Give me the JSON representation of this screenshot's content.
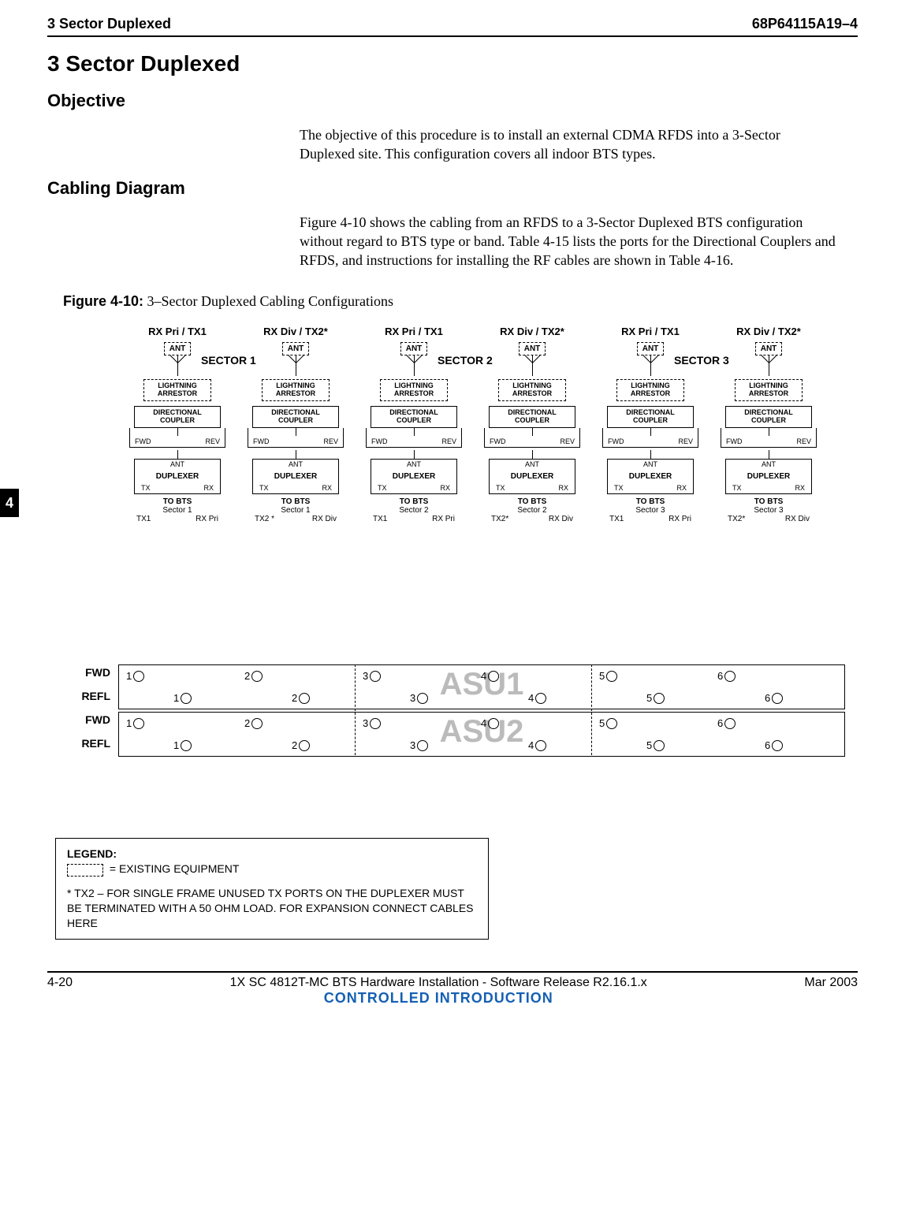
{
  "header": {
    "left": "3 Sector Duplexed",
    "right": "68P64115A19–4"
  },
  "title": "3 Sector Duplexed",
  "objective": {
    "heading": "Objective",
    "text": "The objective of this procedure is to install an external CDMA RFDS into a 3-Sector Duplexed site. This configuration covers all indoor BTS types."
  },
  "cabling": {
    "heading": "Cabling Diagram",
    "text": "Figure 4-10 shows the cabling from an RFDS to a 3-Sector Duplexed BTS configuration without regard to BTS type or band.  Table 4-15 lists the ports for the Directional Couplers and RFDS, and instructions for installing the RF cables are shown in Table 4-16."
  },
  "figure": {
    "label": "Figure 4-10:",
    "caption": "3–Sector Duplexed Cabling Configurations"
  },
  "sectors": [
    "SECTOR 1",
    "SECTOR 2",
    "SECTOR 3"
  ],
  "columns": [
    {
      "top": "RX Pri / TX1",
      "bts": {
        "sector": "Sector 1",
        "left": "TX1",
        "right": "RX Pri"
      }
    },
    {
      "top": "RX Div / TX2*",
      "bts": {
        "sector": "Sector 1",
        "left": "TX2 *",
        "right": "RX Div"
      }
    },
    {
      "top": "RX Pri / TX1",
      "bts": {
        "sector": "Sector 2",
        "left": "TX1",
        "right": "RX Pri"
      }
    },
    {
      "top": "RX Div / TX2*",
      "bts": {
        "sector": "Sector 2",
        "left": "TX2*",
        "right": "RX Div"
      }
    },
    {
      "top": "RX Pri / TX1",
      "bts": {
        "sector": "Sector 3",
        "left": "TX1",
        "right": "RX Pri"
      }
    },
    {
      "top": "RX Div / TX2*",
      "bts": {
        "sector": "Sector 3",
        "left": "TX2*",
        "right": "RX Div"
      }
    }
  ],
  "labels": {
    "ant": "ANT",
    "la1": "LIGHTNING",
    "la2": "ARRESTOR",
    "dc1": "DIRECTIONAL",
    "dc2": "COUPLER",
    "fwd": "FWD",
    "rev": "REV",
    "dup": "DUPLEXER",
    "antport": "ANT",
    "tx": "TX",
    "rx": "RX",
    "tobts": "TO BTS"
  },
  "asu": {
    "rows": [
      "FWD",
      "REFL",
      "FWD",
      "REFL"
    ],
    "name1": "ASU1",
    "name2": "ASU2",
    "ports": [
      1,
      2,
      3,
      4,
      5,
      6
    ]
  },
  "tab": "4",
  "legend": {
    "title": "LEGEND:",
    "existing": "= EXISTING EQUIPMENT",
    "note": "* TX2 – FOR SINGLE FRAME  UNUSED TX PORTS ON THE DUPLEXER MUST BE TERMINATED WITH A 50 OHM LOAD. FOR EXPANSION CONNECT CABLES HERE"
  },
  "footer": {
    "page": "4-20",
    "title": "1X SC 4812T-MC BTS Hardware Installation - Software Release R2.16.1.x",
    "ci": "CONTROLLED INTRODUCTION",
    "date": "Mar 2003"
  }
}
